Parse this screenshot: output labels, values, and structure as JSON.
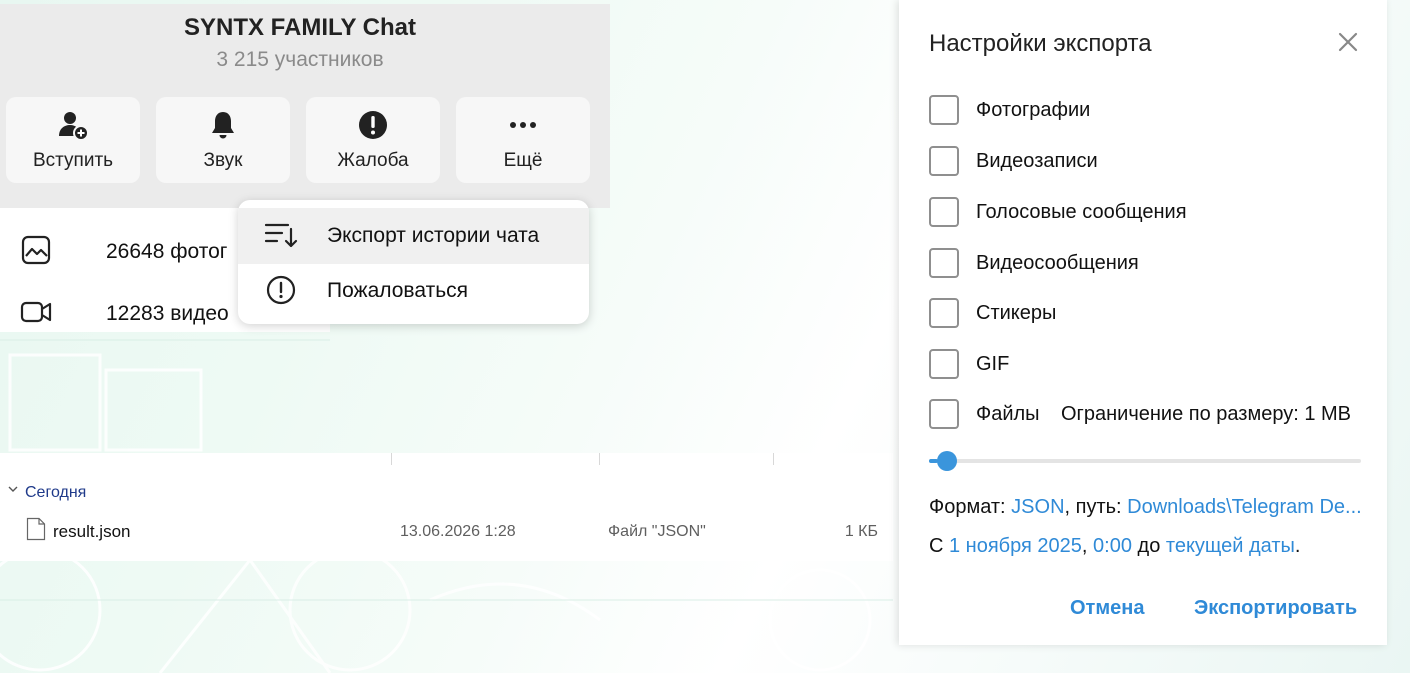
{
  "chat": {
    "title": "SYNTX FAMILY Chat",
    "subtitle": "3 215 участников",
    "actions": [
      {
        "label": "Вступить",
        "icon": "add-user-icon"
      },
      {
        "label": "Звук",
        "icon": "bell-icon"
      },
      {
        "label": "Жалоба",
        "icon": "alert-icon"
      },
      {
        "label": "Ещё",
        "icon": "more-icon"
      }
    ],
    "media": [
      {
        "label": "26648 фотог",
        "icon": "photo-icon"
      },
      {
        "label": "12283 видео",
        "icon": "video-icon"
      }
    ]
  },
  "context_menu": {
    "items": [
      {
        "label": "Экспорт истории чата",
        "icon": "export-sort-icon",
        "highlighted": true
      },
      {
        "label": "Пожаловаться",
        "icon": "report-icon",
        "highlighted": false
      }
    ]
  },
  "explorer": {
    "group_label": "Сегодня",
    "file": {
      "name": "result.json",
      "date": "13.06.2026 1:28",
      "type": "Файл \"JSON\"",
      "size": "1 КБ"
    }
  },
  "export_dialog": {
    "title": "Настройки экспорта",
    "options": [
      {
        "label": "Фотографии",
        "checked": false
      },
      {
        "label": "Видеозаписи",
        "checked": false
      },
      {
        "label": "Голосовые сообщения",
        "checked": false
      },
      {
        "label": "Видеосообщения",
        "checked": false
      },
      {
        "label": "Стикеры",
        "checked": false
      },
      {
        "label": "GIF",
        "checked": false
      },
      {
        "label": "Файлы",
        "checked": false
      }
    ],
    "size_limit_label": "Ограничение по размеру: 1 MB",
    "size_limit_fraction": 0.02,
    "format_prefix": "Формат: ",
    "format_value": "JSON",
    "path_prefix": ", путь: ",
    "path_value": "Downloads\\Telegram De...",
    "range_prefix": "С ",
    "range_start_date": "1 ноября 2025",
    "range_comma": ", ",
    "range_start_time": "0:00",
    "range_middle": " до ",
    "range_end": "текущей даты",
    "range_suffix": ".",
    "cancel_label": "Отмена",
    "export_label": "Экспортировать"
  },
  "colors": {
    "accent": "#2f8ad7",
    "slider": "#3a95dc",
    "header_bg": "#ebebeb"
  }
}
